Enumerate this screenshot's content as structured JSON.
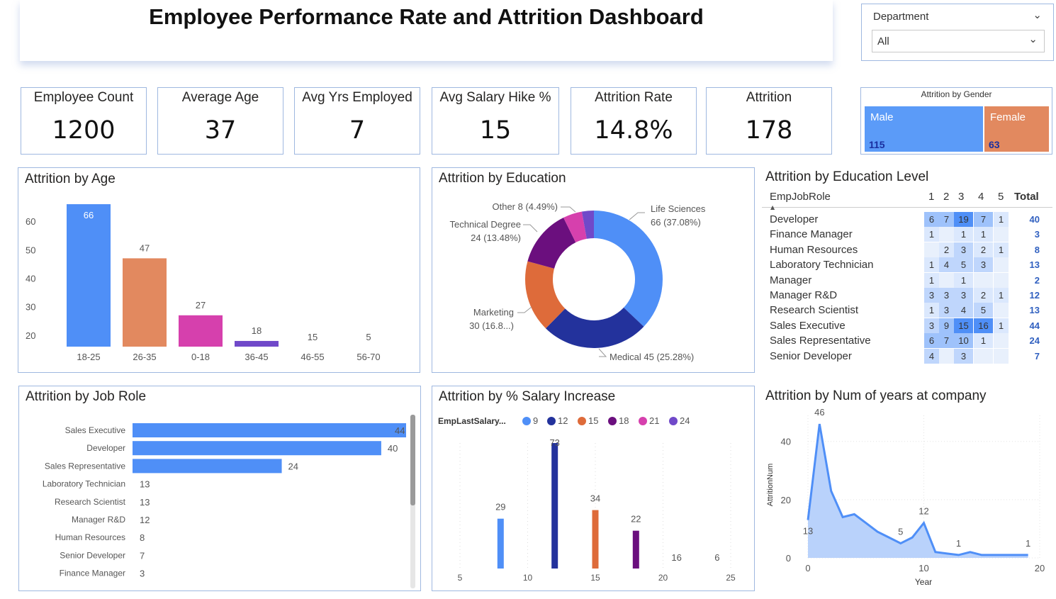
{
  "title": "Employee Performance Rate and Attrition Dashboard",
  "slicer": {
    "label": "Department",
    "value": "All"
  },
  "kpis": [
    {
      "label": "Employee Count",
      "value": "1200"
    },
    {
      "label": "Average Age",
      "value": "37"
    },
    {
      "label": "Avg Yrs Employed",
      "value": "7"
    },
    {
      "label": "Avg Salary Hike %",
      "value": "15"
    },
    {
      "label": "Attrition Rate",
      "value": "14.8%"
    },
    {
      "label": "Attrition",
      "value": "178"
    }
  ],
  "gender": {
    "title": "Attrition by Gender",
    "male_label": "Male",
    "male_value": "115",
    "female_label": "Female",
    "female_value": "63",
    "male_count": 115,
    "female_count": 63,
    "male_color": "#5b9bf8",
    "female_color": "#e2895f"
  },
  "panels": {
    "age": "Attrition by Age",
    "education": "Attrition by Education",
    "edu_level": "Attrition by Education Level",
    "job_role": "Attrition by Job Role",
    "salary": "Attrition by % Salary Increase",
    "years": "Attrition by Num of years at company"
  },
  "edu_matrix": {
    "row_header": "EmpJobRole",
    "levels": [
      "1",
      "2",
      "3",
      "4",
      "5"
    ],
    "total_header": "Total",
    "rows": [
      {
        "role": "Developer",
        "cells": [
          "6",
          "7",
          "19",
          "7",
          "1"
        ],
        "total": "40"
      },
      {
        "role": "Finance Manager",
        "cells": [
          "1",
          "",
          "1",
          "1",
          ""
        ],
        "total": "3"
      },
      {
        "role": "Human Resources",
        "cells": [
          "",
          "2",
          "3",
          "2",
          "1"
        ],
        "total": "8"
      },
      {
        "role": "Laboratory Technician",
        "cells": [
          "1",
          "4",
          "5",
          "3",
          ""
        ],
        "total": "13"
      },
      {
        "role": "Manager",
        "cells": [
          "1",
          "",
          "1",
          "",
          ""
        ],
        "total": "2"
      },
      {
        "role": "Manager R&D",
        "cells": [
          "3",
          "3",
          "3",
          "2",
          "1"
        ],
        "total": "12"
      },
      {
        "role": "Research Scientist",
        "cells": [
          "1",
          "3",
          "4",
          "5",
          ""
        ],
        "total": "13"
      },
      {
        "role": "Sales Executive",
        "cells": [
          "3",
          "9",
          "15",
          "16",
          "1"
        ],
        "total": "44"
      },
      {
        "role": "Sales Representative",
        "cells": [
          "6",
          "7",
          "10",
          "1",
          ""
        ],
        "total": "24"
      },
      {
        "role": "Senior Developer",
        "cells": [
          "4",
          "",
          "3",
          "",
          ""
        ],
        "total": "7"
      }
    ]
  },
  "chart_data": [
    {
      "type": "bar",
      "title": "Attrition by Age",
      "categories": [
        "18-25",
        "26-35",
        "0-18",
        "36-45",
        "46-55",
        "56-70"
      ],
      "values": [
        66,
        47,
        27,
        18,
        15,
        5
      ],
      "colors": [
        "#4f8ff7",
        "#e2895f",
        "#d640ad",
        "#7049c9",
        "#4f8ff7",
        "#4f8ff7"
      ],
      "yticks": [
        20,
        30,
        40,
        50,
        60
      ],
      "ylim": [
        17,
        68
      ]
    },
    {
      "type": "pie",
      "title": "Attrition by Education",
      "slices": [
        {
          "label": "Life Sciences",
          "value": 66,
          "text": "66 (37.08%)",
          "color": "#4f8ff7"
        },
        {
          "label": "Medical",
          "value": 45,
          "text": "45 (25.28%)",
          "color": "#23329c"
        },
        {
          "label": "Marketing",
          "value": 30,
          "text": "30 (16.8...)",
          "color": "#de6b3a"
        },
        {
          "label": "Technical Degree",
          "value": 24,
          "text": "24 (13.48%)",
          "color": "#6b0f7e"
        },
        {
          "label": "Other",
          "value": 8,
          "text": "8 (4.49%)",
          "color": "#d640ad"
        },
        {
          "label": "",
          "value": 5,
          "text": "",
          "color": "#7049c9"
        }
      ]
    },
    {
      "type": "bar",
      "title": "Attrition by Job Role",
      "categories": [
        "Sales Executive",
        "Developer",
        "Sales Representative",
        "Laboratory Technician",
        "Research Scientist",
        "Manager R&D",
        "Human Resources",
        "Senior Developer",
        "Finance Manager"
      ],
      "values": [
        44,
        40,
        24,
        13,
        13,
        12,
        8,
        7,
        3
      ],
      "color": "#4f8ff7",
      "xlim": [
        0,
        44
      ]
    },
    {
      "type": "bar",
      "title": "Attrition by % Salary Increase",
      "legend_title": "EmpLastSalary...",
      "series": [
        {
          "name": "9",
          "x": 8,
          "value": 29,
          "color": "#4f8ff7"
        },
        {
          "name": "12",
          "x": 12,
          "value": 73,
          "color": "#23329c"
        },
        {
          "name": "15",
          "x": 15,
          "value": 34,
          "color": "#de6b3a"
        },
        {
          "name": "18",
          "x": 18,
          "value": 22,
          "color": "#6b0f7e"
        },
        {
          "name": "21",
          "x": 21,
          "value": 16,
          "color": "#d640ad"
        },
        {
          "name": "24",
          "x": 24,
          "value": 6,
          "color": "#7049c9"
        }
      ],
      "data_labels": [
        "29",
        "73",
        "34",
        "22",
        "16",
        "6"
      ],
      "xticks": [
        5,
        10,
        15,
        20,
        25
      ],
      "xlim": [
        5,
        25
      ],
      "ylim": [
        0,
        73
      ]
    },
    {
      "type": "area",
      "title": "Attrition by Num of years at company",
      "xlabel": "Year",
      "ylabel": "AttritionNum",
      "x": [
        0,
        1,
        2,
        3,
        4,
        5,
        6,
        7,
        8,
        9,
        10,
        11,
        12,
        13,
        14,
        15,
        16,
        17,
        18,
        19
      ],
      "values": [
        13,
        46,
        23,
        14,
        15,
        12,
        9,
        7,
        5,
        7,
        12,
        2,
        1.5,
        1,
        2,
        1,
        1,
        1,
        1,
        1
      ],
      "point_labels": [
        {
          "x": 0,
          "text": "13"
        },
        {
          "x": 1,
          "text": "46"
        },
        {
          "x": 8,
          "text": "5"
        },
        {
          "x": 10,
          "text": "12"
        },
        {
          "x": 13,
          "text": "1"
        },
        {
          "x": 19,
          "text": "1"
        }
      ],
      "xticks": [
        0,
        10,
        20
      ],
      "yticks": [
        0,
        20,
        40
      ],
      "xlim": [
        0,
        20
      ],
      "ylim": [
        0,
        47
      ],
      "grid": true,
      "color": "#4f8ff7"
    }
  ]
}
